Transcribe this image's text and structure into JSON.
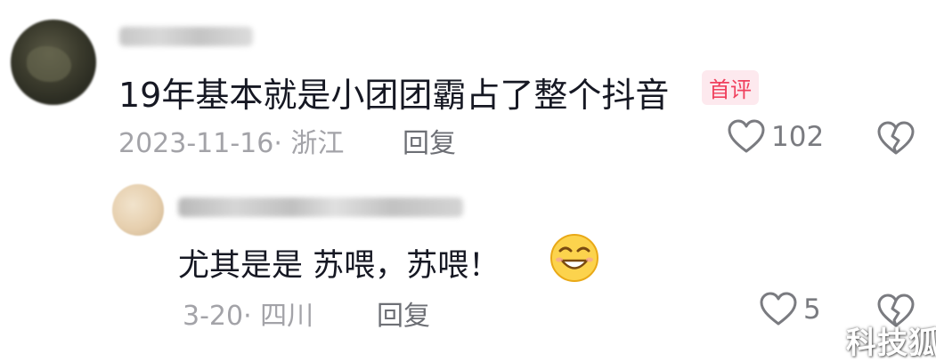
{
  "comment": {
    "text": "19年基本就是小团团霸占了整个抖音",
    "badge": "首评",
    "meta": "2023-11-16· 浙江",
    "reply_label": "回复",
    "likes": "102"
  },
  "reply": {
    "text": "尤其是是 苏喂，苏喂！",
    "meta": "3-20· 四川",
    "reply_label": "回复",
    "likes": "5",
    "emoji": "grinning-squint-emoji"
  },
  "watermark": "科技狐",
  "icons": {
    "like": "heart-outline-icon",
    "dislike": "broken-heart-icon"
  },
  "colors": {
    "badge_text": "#f0405d",
    "badge_bg": "#fde9ee",
    "meta": "#a3a3a8",
    "text": "#161823"
  }
}
